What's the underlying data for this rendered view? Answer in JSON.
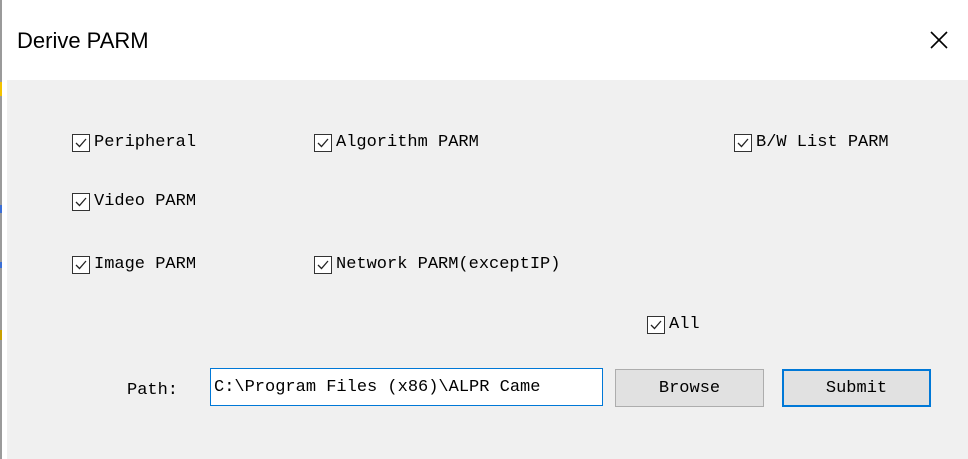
{
  "window": {
    "title": "Derive PARM",
    "close_icon": "close-icon"
  },
  "options": {
    "peripheral": {
      "label": "Peripheral",
      "checked": true
    },
    "algorithm": {
      "label": "Algorithm PARM",
      "checked": true
    },
    "bw_list": {
      "label": "B/W List PARM",
      "checked": true
    },
    "video": {
      "label": "Video PARM",
      "checked": true
    },
    "image": {
      "label": "Image PARM",
      "checked": true
    },
    "network": {
      "label": "Network PARM(exceptIP)",
      "checked": true
    },
    "all": {
      "label": "All",
      "checked": true
    }
  },
  "path": {
    "label": "Path:",
    "value": "C:\\Program Files (x86)\\ALPR Came"
  },
  "buttons": {
    "browse": "Browse",
    "submit": "Submit"
  },
  "colors": {
    "accent": "#0078d7",
    "dialog_bg": "#f0f0f0",
    "titlebar_bg": "#ffffff",
    "button_bg": "#e1e1e1"
  }
}
